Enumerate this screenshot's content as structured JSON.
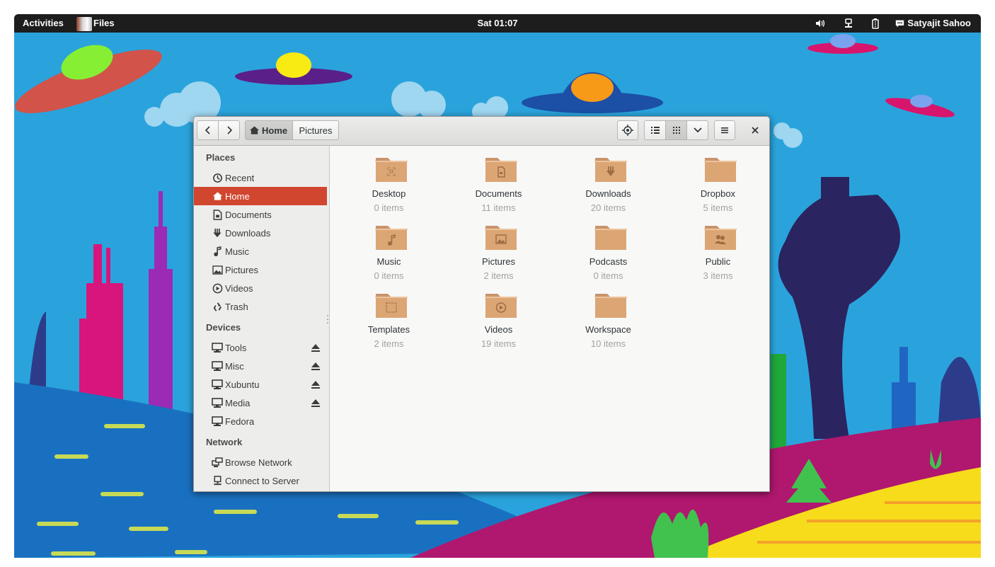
{
  "top_bar": {
    "activities": "Activities",
    "app_menu": "Files",
    "clock": "Sat 01:07",
    "user": "Satyajit Sahoo",
    "tray_icons": [
      "volume-icon",
      "network-wired-icon",
      "battery-icon",
      "chat-icon"
    ]
  },
  "window": {
    "breadcrumbs": [
      {
        "label": "Home",
        "icon": "home-icon",
        "active": true
      },
      {
        "label": "Pictures",
        "active": false
      }
    ],
    "toolbar_icons": [
      "back-arrow-icon",
      "forward-arrow-icon",
      "location-target-icon",
      "list-view-icon",
      "grid-view-icon",
      "chevron-down-icon",
      "hamburger-menu-icon",
      "close-icon"
    ],
    "active_view": "grid"
  },
  "sidebar": {
    "places_heading": "Places",
    "places": [
      {
        "label": "Recent",
        "icon": "recent-clock-icon",
        "active": false
      },
      {
        "label": "Home",
        "icon": "home-icon",
        "active": true
      },
      {
        "label": "Documents",
        "icon": "document-icon",
        "active": false
      },
      {
        "label": "Downloads",
        "icon": "download-icon",
        "active": false
      },
      {
        "label": "Music",
        "icon": "music-note-icon",
        "active": false
      },
      {
        "label": "Pictures",
        "icon": "picture-icon",
        "active": false
      },
      {
        "label": "Videos",
        "icon": "video-play-icon",
        "active": false
      },
      {
        "label": "Trash",
        "icon": "trash-recycle-icon",
        "active": false
      }
    ],
    "devices_heading": "Devices",
    "devices": [
      {
        "label": "Tools",
        "icon": "drive-icon",
        "ejectable": true
      },
      {
        "label": "Misc",
        "icon": "drive-icon",
        "ejectable": true
      },
      {
        "label": "Xubuntu",
        "icon": "drive-icon",
        "ejectable": true
      },
      {
        "label": "Media",
        "icon": "drive-icon",
        "ejectable": true
      },
      {
        "label": "Fedora",
        "icon": "drive-icon",
        "ejectable": false
      }
    ],
    "network_heading": "Network",
    "network": [
      {
        "label": "Browse Network",
        "icon": "network-icon"
      },
      {
        "label": "Connect to Server",
        "icon": "server-icon"
      }
    ]
  },
  "folders": [
    {
      "name": "Desktop",
      "count": "0 items",
      "emblem": "desktop-emblem"
    },
    {
      "name": "Documents",
      "count": "11 items",
      "emblem": "document-emblem"
    },
    {
      "name": "Downloads",
      "count": "20 items",
      "emblem": "download-emblem"
    },
    {
      "name": "Dropbox",
      "count": "5 items",
      "emblem": "none"
    },
    {
      "name": "Music",
      "count": "0 items",
      "emblem": "music-emblem"
    },
    {
      "name": "Pictures",
      "count": "2 items",
      "emblem": "picture-emblem"
    },
    {
      "name": "Podcasts",
      "count": "0 items",
      "emblem": "none"
    },
    {
      "name": "Public",
      "count": "3 items",
      "emblem": "people-emblem"
    },
    {
      "name": "Templates",
      "count": "2 items",
      "emblem": "template-emblem"
    },
    {
      "name": "Videos",
      "count": "19 items",
      "emblem": "video-emblem"
    },
    {
      "name": "Workspace",
      "count": "10 items",
      "emblem": "none"
    }
  ],
  "colors": {
    "sidebar_active": "#d1462f",
    "folder": "#dca574",
    "topbar": "#1d1d1d",
    "wallpaper_sky": "#2aa3dc"
  }
}
